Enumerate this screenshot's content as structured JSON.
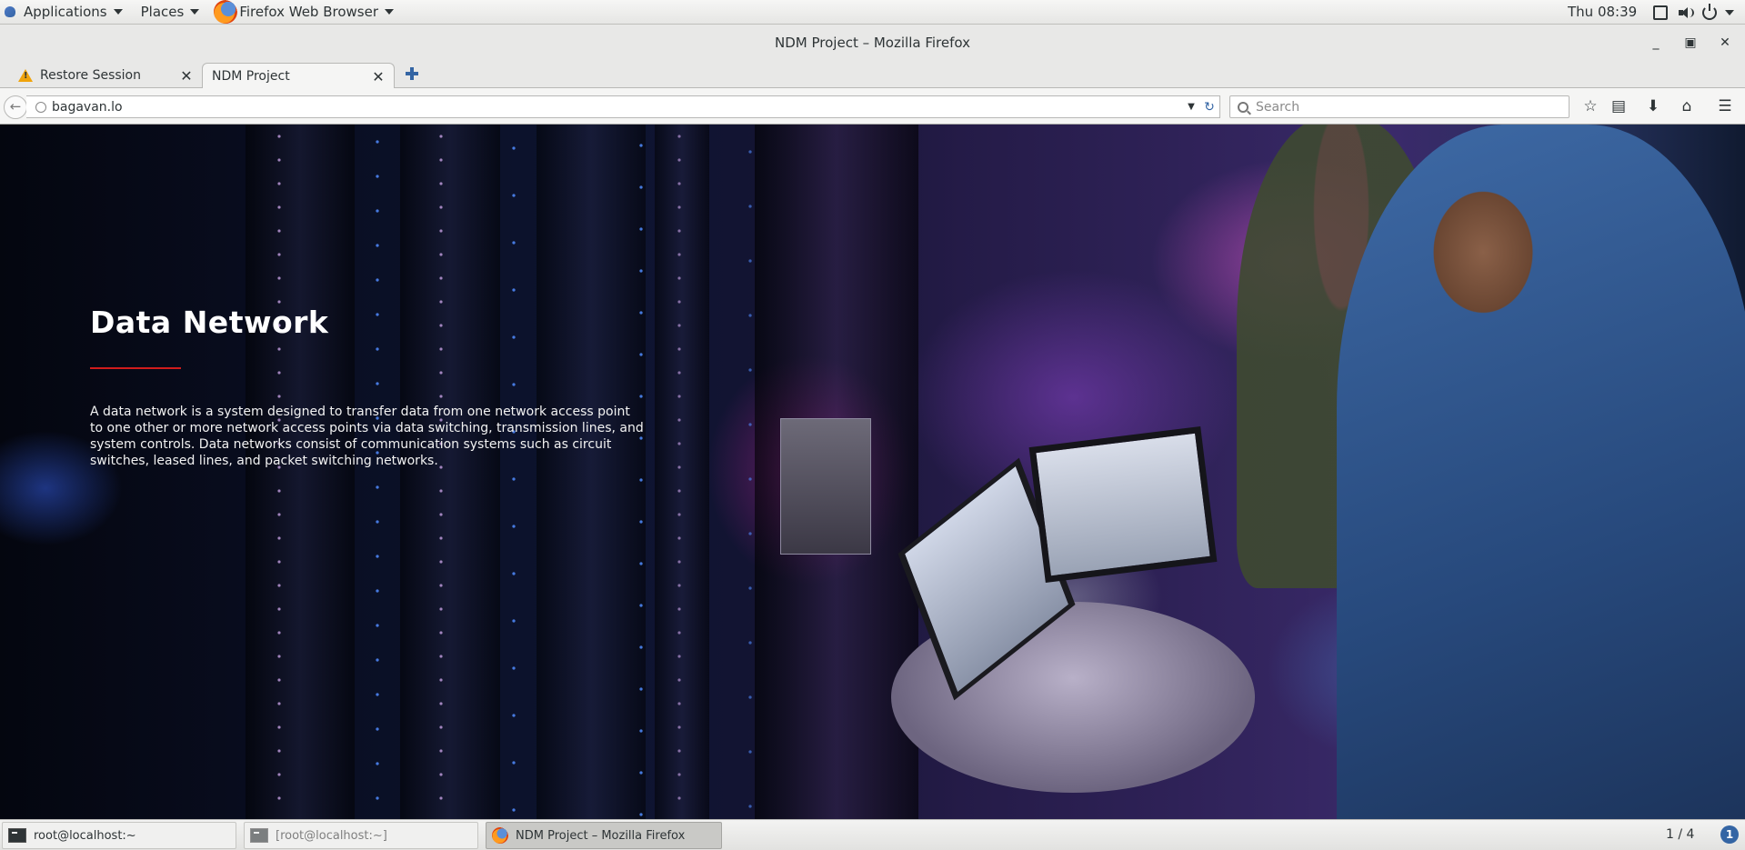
{
  "topbar": {
    "applications_label": "Applications",
    "places_label": "Places",
    "app_label": "Firefox Web Browser",
    "clock": "Thu 08:39"
  },
  "window": {
    "title": "NDM Project – Mozilla Firefox"
  },
  "tabs": [
    {
      "label": "Restore Session",
      "active": false,
      "icon": "warning-icon"
    },
    {
      "label": "NDM Project",
      "active": true
    }
  ],
  "navbar": {
    "url": "bagavan.lo",
    "search_placeholder": "Search"
  },
  "page": {
    "title": "Data Network",
    "description": "A data network is a system designed to transfer data from one network access point to one other or more network access points via data switching, transmission lines, and system controls. Data networks consist of communication systems such as circuit switches, leased lines, and packet switching networks.",
    "accent_color": "#d11c1c"
  },
  "taskbar": {
    "items": [
      {
        "label": "root@localhost:~",
        "icon": "terminal-icon"
      },
      {
        "label": "[root@localhost:~]",
        "icon": "terminal-icon"
      },
      {
        "label": "NDM Project – Mozilla Firefox",
        "icon": "firefox-icon"
      }
    ],
    "workspace": "1 / 4",
    "notification_count": "1"
  }
}
